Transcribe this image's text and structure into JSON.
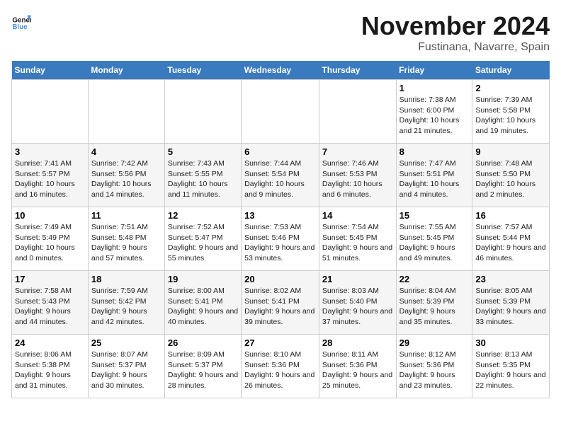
{
  "logo": {
    "text_general": "General",
    "text_blue": "Blue"
  },
  "header": {
    "month": "November 2024",
    "location": "Fustinana, Navarre, Spain"
  },
  "days_of_week": [
    "Sunday",
    "Monday",
    "Tuesday",
    "Wednesday",
    "Thursday",
    "Friday",
    "Saturday"
  ],
  "weeks": [
    [
      {
        "day": "",
        "info": ""
      },
      {
        "day": "",
        "info": ""
      },
      {
        "day": "",
        "info": ""
      },
      {
        "day": "",
        "info": ""
      },
      {
        "day": "",
        "info": ""
      },
      {
        "day": "1",
        "info": "Sunrise: 7:38 AM\nSunset: 6:00 PM\nDaylight: 10 hours and 21 minutes."
      },
      {
        "day": "2",
        "info": "Sunrise: 7:39 AM\nSunset: 5:58 PM\nDaylight: 10 hours and 19 minutes."
      }
    ],
    [
      {
        "day": "3",
        "info": "Sunrise: 7:41 AM\nSunset: 5:57 PM\nDaylight: 10 hours and 16 minutes."
      },
      {
        "day": "4",
        "info": "Sunrise: 7:42 AM\nSunset: 5:56 PM\nDaylight: 10 hours and 14 minutes."
      },
      {
        "day": "5",
        "info": "Sunrise: 7:43 AM\nSunset: 5:55 PM\nDaylight: 10 hours and 11 minutes."
      },
      {
        "day": "6",
        "info": "Sunrise: 7:44 AM\nSunset: 5:54 PM\nDaylight: 10 hours and 9 minutes."
      },
      {
        "day": "7",
        "info": "Sunrise: 7:46 AM\nSunset: 5:53 PM\nDaylight: 10 hours and 6 minutes."
      },
      {
        "day": "8",
        "info": "Sunrise: 7:47 AM\nSunset: 5:51 PM\nDaylight: 10 hours and 4 minutes."
      },
      {
        "day": "9",
        "info": "Sunrise: 7:48 AM\nSunset: 5:50 PM\nDaylight: 10 hours and 2 minutes."
      }
    ],
    [
      {
        "day": "10",
        "info": "Sunrise: 7:49 AM\nSunset: 5:49 PM\nDaylight: 10 hours and 0 minutes."
      },
      {
        "day": "11",
        "info": "Sunrise: 7:51 AM\nSunset: 5:48 PM\nDaylight: 9 hours and 57 minutes."
      },
      {
        "day": "12",
        "info": "Sunrise: 7:52 AM\nSunset: 5:47 PM\nDaylight: 9 hours and 55 minutes."
      },
      {
        "day": "13",
        "info": "Sunrise: 7:53 AM\nSunset: 5:46 PM\nDaylight: 9 hours and 53 minutes."
      },
      {
        "day": "14",
        "info": "Sunrise: 7:54 AM\nSunset: 5:45 PM\nDaylight: 9 hours and 51 minutes."
      },
      {
        "day": "15",
        "info": "Sunrise: 7:55 AM\nSunset: 5:45 PM\nDaylight: 9 hours and 49 minutes."
      },
      {
        "day": "16",
        "info": "Sunrise: 7:57 AM\nSunset: 5:44 PM\nDaylight: 9 hours and 46 minutes."
      }
    ],
    [
      {
        "day": "17",
        "info": "Sunrise: 7:58 AM\nSunset: 5:43 PM\nDaylight: 9 hours and 44 minutes."
      },
      {
        "day": "18",
        "info": "Sunrise: 7:59 AM\nSunset: 5:42 PM\nDaylight: 9 hours and 42 minutes."
      },
      {
        "day": "19",
        "info": "Sunrise: 8:00 AM\nSunset: 5:41 PM\nDaylight: 9 hours and 40 minutes."
      },
      {
        "day": "20",
        "info": "Sunrise: 8:02 AM\nSunset: 5:41 PM\nDaylight: 9 hours and 39 minutes."
      },
      {
        "day": "21",
        "info": "Sunrise: 8:03 AM\nSunset: 5:40 PM\nDaylight: 9 hours and 37 minutes."
      },
      {
        "day": "22",
        "info": "Sunrise: 8:04 AM\nSunset: 5:39 PM\nDaylight: 9 hours and 35 minutes."
      },
      {
        "day": "23",
        "info": "Sunrise: 8:05 AM\nSunset: 5:39 PM\nDaylight: 9 hours and 33 minutes."
      }
    ],
    [
      {
        "day": "24",
        "info": "Sunrise: 8:06 AM\nSunset: 5:38 PM\nDaylight: 9 hours and 31 minutes."
      },
      {
        "day": "25",
        "info": "Sunrise: 8:07 AM\nSunset: 5:37 PM\nDaylight: 9 hours and 30 minutes."
      },
      {
        "day": "26",
        "info": "Sunrise: 8:09 AM\nSunset: 5:37 PM\nDaylight: 9 hours and 28 minutes."
      },
      {
        "day": "27",
        "info": "Sunrise: 8:10 AM\nSunset: 5:36 PM\nDaylight: 9 hours and 26 minutes."
      },
      {
        "day": "28",
        "info": "Sunrise: 8:11 AM\nSunset: 5:36 PM\nDaylight: 9 hours and 25 minutes."
      },
      {
        "day": "29",
        "info": "Sunrise: 8:12 AM\nSunset: 5:36 PM\nDaylight: 9 hours and 23 minutes."
      },
      {
        "day": "30",
        "info": "Sunrise: 8:13 AM\nSunset: 5:35 PM\nDaylight: 9 hours and 22 minutes."
      }
    ]
  ]
}
